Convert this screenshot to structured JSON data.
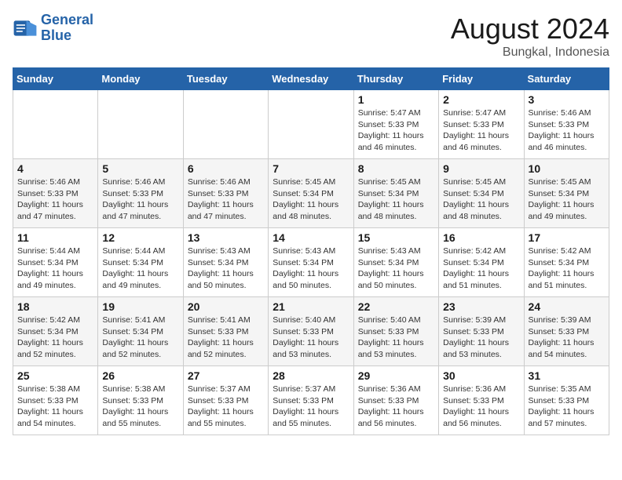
{
  "app": {
    "name": "GeneralBlue",
    "logo_line1": "General",
    "logo_line2": "Blue"
  },
  "calendar": {
    "title": "August 2024",
    "subtitle": "Bungkal, Indonesia"
  },
  "weekdays": [
    "Sunday",
    "Monday",
    "Tuesday",
    "Wednesday",
    "Thursday",
    "Friday",
    "Saturday"
  ],
  "weeks": [
    [
      {
        "day": "",
        "info": ""
      },
      {
        "day": "",
        "info": ""
      },
      {
        "day": "",
        "info": ""
      },
      {
        "day": "",
        "info": ""
      },
      {
        "day": "1",
        "info": "Sunrise: 5:47 AM\nSunset: 5:33 PM\nDaylight: 11 hours\nand 46 minutes."
      },
      {
        "day": "2",
        "info": "Sunrise: 5:47 AM\nSunset: 5:33 PM\nDaylight: 11 hours\nand 46 minutes."
      },
      {
        "day": "3",
        "info": "Sunrise: 5:46 AM\nSunset: 5:33 PM\nDaylight: 11 hours\nand 46 minutes."
      }
    ],
    [
      {
        "day": "4",
        "info": "Sunrise: 5:46 AM\nSunset: 5:33 PM\nDaylight: 11 hours\nand 47 minutes."
      },
      {
        "day": "5",
        "info": "Sunrise: 5:46 AM\nSunset: 5:33 PM\nDaylight: 11 hours\nand 47 minutes."
      },
      {
        "day": "6",
        "info": "Sunrise: 5:46 AM\nSunset: 5:33 PM\nDaylight: 11 hours\nand 47 minutes."
      },
      {
        "day": "7",
        "info": "Sunrise: 5:45 AM\nSunset: 5:34 PM\nDaylight: 11 hours\nand 48 minutes."
      },
      {
        "day": "8",
        "info": "Sunrise: 5:45 AM\nSunset: 5:34 PM\nDaylight: 11 hours\nand 48 minutes."
      },
      {
        "day": "9",
        "info": "Sunrise: 5:45 AM\nSunset: 5:34 PM\nDaylight: 11 hours\nand 48 minutes."
      },
      {
        "day": "10",
        "info": "Sunrise: 5:45 AM\nSunset: 5:34 PM\nDaylight: 11 hours\nand 49 minutes."
      }
    ],
    [
      {
        "day": "11",
        "info": "Sunrise: 5:44 AM\nSunset: 5:34 PM\nDaylight: 11 hours\nand 49 minutes."
      },
      {
        "day": "12",
        "info": "Sunrise: 5:44 AM\nSunset: 5:34 PM\nDaylight: 11 hours\nand 49 minutes."
      },
      {
        "day": "13",
        "info": "Sunrise: 5:43 AM\nSunset: 5:34 PM\nDaylight: 11 hours\nand 50 minutes."
      },
      {
        "day": "14",
        "info": "Sunrise: 5:43 AM\nSunset: 5:34 PM\nDaylight: 11 hours\nand 50 minutes."
      },
      {
        "day": "15",
        "info": "Sunrise: 5:43 AM\nSunset: 5:34 PM\nDaylight: 11 hours\nand 50 minutes."
      },
      {
        "day": "16",
        "info": "Sunrise: 5:42 AM\nSunset: 5:34 PM\nDaylight: 11 hours\nand 51 minutes."
      },
      {
        "day": "17",
        "info": "Sunrise: 5:42 AM\nSunset: 5:34 PM\nDaylight: 11 hours\nand 51 minutes."
      }
    ],
    [
      {
        "day": "18",
        "info": "Sunrise: 5:42 AM\nSunset: 5:34 PM\nDaylight: 11 hours\nand 52 minutes."
      },
      {
        "day": "19",
        "info": "Sunrise: 5:41 AM\nSunset: 5:34 PM\nDaylight: 11 hours\nand 52 minutes."
      },
      {
        "day": "20",
        "info": "Sunrise: 5:41 AM\nSunset: 5:33 PM\nDaylight: 11 hours\nand 52 minutes."
      },
      {
        "day": "21",
        "info": "Sunrise: 5:40 AM\nSunset: 5:33 PM\nDaylight: 11 hours\nand 53 minutes."
      },
      {
        "day": "22",
        "info": "Sunrise: 5:40 AM\nSunset: 5:33 PM\nDaylight: 11 hours\nand 53 minutes."
      },
      {
        "day": "23",
        "info": "Sunrise: 5:39 AM\nSunset: 5:33 PM\nDaylight: 11 hours\nand 53 minutes."
      },
      {
        "day": "24",
        "info": "Sunrise: 5:39 AM\nSunset: 5:33 PM\nDaylight: 11 hours\nand 54 minutes."
      }
    ],
    [
      {
        "day": "25",
        "info": "Sunrise: 5:38 AM\nSunset: 5:33 PM\nDaylight: 11 hours\nand 54 minutes."
      },
      {
        "day": "26",
        "info": "Sunrise: 5:38 AM\nSunset: 5:33 PM\nDaylight: 11 hours\nand 55 minutes."
      },
      {
        "day": "27",
        "info": "Sunrise: 5:37 AM\nSunset: 5:33 PM\nDaylight: 11 hours\nand 55 minutes."
      },
      {
        "day": "28",
        "info": "Sunrise: 5:37 AM\nSunset: 5:33 PM\nDaylight: 11 hours\nand 55 minutes."
      },
      {
        "day": "29",
        "info": "Sunrise: 5:36 AM\nSunset: 5:33 PM\nDaylight: 11 hours\nand 56 minutes."
      },
      {
        "day": "30",
        "info": "Sunrise: 5:36 AM\nSunset: 5:33 PM\nDaylight: 11 hours\nand 56 minutes."
      },
      {
        "day": "31",
        "info": "Sunrise: 5:35 AM\nSunset: 5:33 PM\nDaylight: 11 hours\nand 57 minutes."
      }
    ]
  ]
}
